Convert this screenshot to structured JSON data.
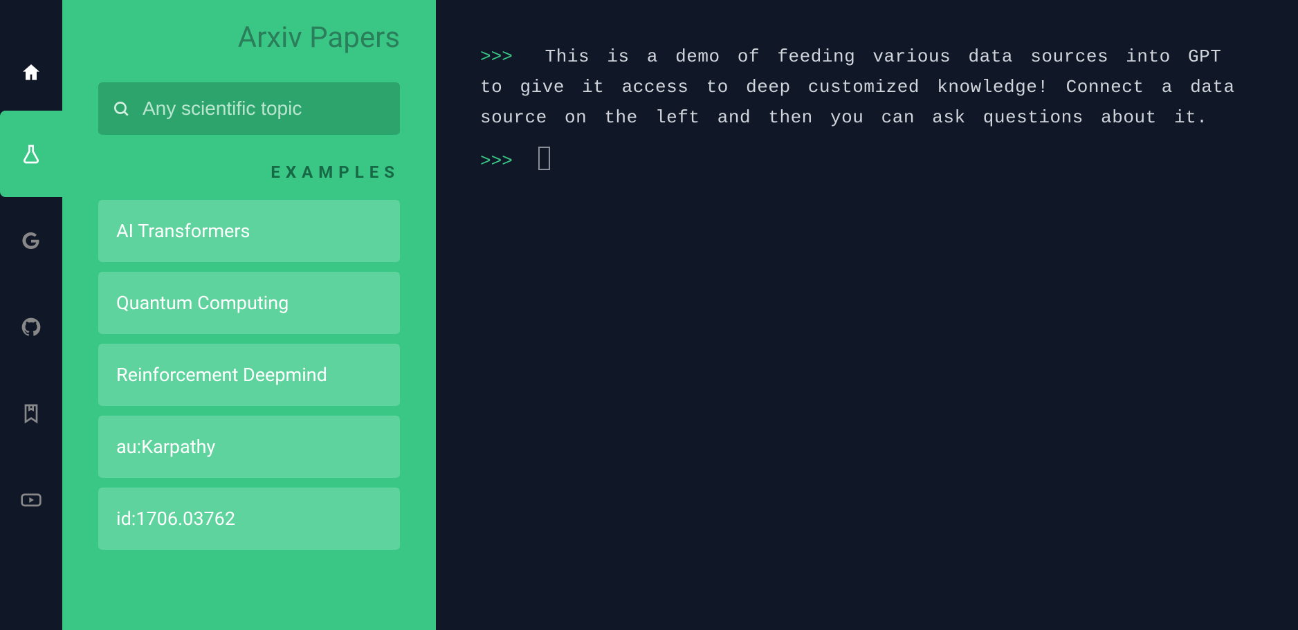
{
  "rail": {
    "items": [
      {
        "name": "home-icon",
        "active": false,
        "interactable": true
      },
      {
        "name": "flask-icon",
        "active": true,
        "interactable": true
      },
      {
        "name": "google-icon",
        "active": false,
        "interactable": true
      },
      {
        "name": "github-icon",
        "active": false,
        "interactable": true
      },
      {
        "name": "bookmark-icon",
        "active": false,
        "interactable": true
      },
      {
        "name": "youtube-icon",
        "active": false,
        "interactable": true
      }
    ]
  },
  "panel": {
    "title": "Arxiv Papers",
    "search": {
      "placeholder": "Any scientific topic",
      "value": ""
    },
    "examples_header": "EXAMPLES",
    "examples": [
      {
        "label": "AI Transformers"
      },
      {
        "label": "Quantum Computing"
      },
      {
        "label": "Reinforcement Deepmind"
      },
      {
        "label": "au:Karpathy"
      },
      {
        "label": "id:1706.03762"
      }
    ]
  },
  "terminal": {
    "prompt": ">>>",
    "intro": "This is a demo of feeding various data sources into GPT to give it access to deep customized knowledge! Connect a data source on the left and then you can ask questions about it."
  }
}
